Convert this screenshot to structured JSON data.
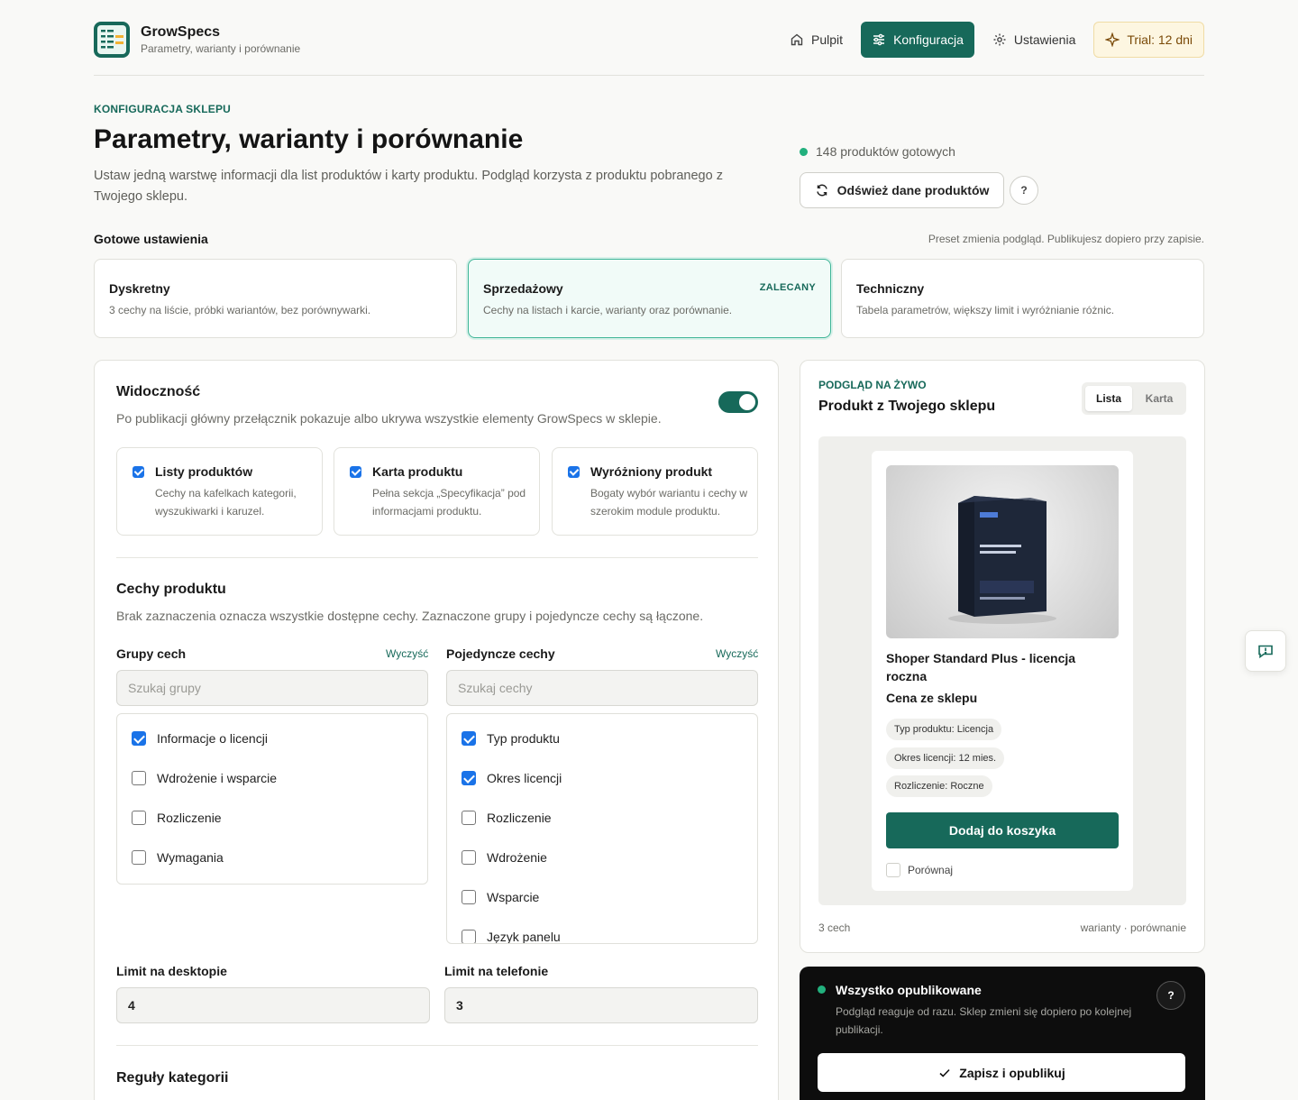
{
  "app": {
    "name": "GrowSpecs",
    "subtitle": "Parametry, warianty i porównanie"
  },
  "nav": {
    "items": [
      {
        "label": "Pulpit",
        "icon": "home-icon",
        "active": false
      },
      {
        "label": "Konfiguracja",
        "icon": "sliders-icon",
        "active": true
      },
      {
        "label": "Ustawienia",
        "icon": "gear-icon",
        "active": false
      }
    ],
    "trial": "Trial: 12 dni"
  },
  "intro": {
    "eyebrow": "KONFIGURACJA SKLEPU",
    "title": "Parametry, warianty i porównanie",
    "lead": "Ustaw jedną warstwę informacji dla list produktów i karty produktu. Podgląd korzysta z produktu pobranego z Twojego sklepu.",
    "ready_status": "148 produktów gotowych",
    "refresh_button": "Odśwież dane produktów",
    "help": "?"
  },
  "presets": {
    "label": "Gotowe ustawienia",
    "note": "Preset zmienia podgląd. Publikujesz dopiero przy zapisie.",
    "items": [
      {
        "title": "Dyskretny",
        "desc": "3 cechy na liście, próbki wariantów, bez porównywarki.",
        "badge": "",
        "selected": false
      },
      {
        "title": "Sprzedażowy",
        "desc": "Cechy na listach i karcie, warianty oraz porównanie.",
        "badge": "ZALECANY",
        "selected": true
      },
      {
        "title": "Techniczny",
        "desc": "Tabela parametrów, większy limit i wyróżnianie różnic.",
        "badge": "",
        "selected": false
      }
    ]
  },
  "visibility": {
    "title": "Widoczność",
    "desc": "Po publikacji główny przełącznik pokazuje albo ukrywa wszystkie elementy GrowSpecs w sklepie.",
    "enabled": true,
    "options": [
      {
        "title": "Listy produktów",
        "desc": "Cechy na kafelkach kategorii, wyszukiwarki i karuzel.",
        "checked": true
      },
      {
        "title": "Karta produktu",
        "desc": "Pełna sekcja „Specyfikacja” pod informacjami produktu.",
        "checked": true
      },
      {
        "title": "Wyróżniony produkt",
        "desc": "Bogaty wybór wariantu i cechy w szerokim module produktu.",
        "checked": true
      }
    ]
  },
  "features": {
    "title": "Cechy produktu",
    "desc": "Brak zaznaczenia oznacza wszystkie dostępne cechy. Zaznaczone grupy i pojedyncze cechy są łączone.",
    "groups": {
      "label": "Grupy cech",
      "clear": "Wyczyść",
      "placeholder": "Szukaj grupy",
      "items": [
        {
          "label": "Informacje o licencji",
          "checked": true
        },
        {
          "label": "Wdrożenie i wsparcie",
          "checked": false
        },
        {
          "label": "Rozliczenie",
          "checked": false
        },
        {
          "label": "Wymagania",
          "checked": false
        }
      ]
    },
    "single": {
      "label": "Pojedyncze cechy",
      "clear": "Wyczyść",
      "placeholder": "Szukaj cechy",
      "items": [
        {
          "label": "Typ produktu",
          "checked": true
        },
        {
          "label": "Okres licencji",
          "checked": true
        },
        {
          "label": "Rozliczenie",
          "checked": false
        },
        {
          "label": "Wdrożenie",
          "checked": false
        },
        {
          "label": "Wsparcie",
          "checked": false
        },
        {
          "label": "Język panelu",
          "checked": false
        }
      ]
    },
    "limit_desktop": {
      "label": "Limit na desktopie",
      "value": "4"
    },
    "limit_mobile": {
      "label": "Limit na telefonie",
      "value": "3"
    }
  },
  "category_rules": {
    "title": "Reguły kategorii"
  },
  "preview": {
    "eyebrow": "PODGLĄD NA ŻYWO",
    "title": "Produkt z Twojego sklepu",
    "tabs": [
      "Lista",
      "Karta"
    ],
    "active_tab": "Lista",
    "product": {
      "name": "Shoper Standard Plus - licencja roczna",
      "price": "Cena ze sklepu",
      "chips": [
        "Typ produktu: Licencja",
        "Okres licencji: 12 mies.",
        "Rozliczenie: Roczne"
      ],
      "add_to_cart": "Dodaj do koszyka",
      "compare": "Porównaj"
    },
    "footer_left": "3 cech",
    "footer_right": "warianty · porównanie"
  },
  "publish": {
    "title": "Wszystko opublikowane",
    "desc": "Podgląd reaguje od razu. Sklep zmieni się dopiero po kolejnej publikacji.",
    "button": "Zapisz i opublikuj",
    "help": "?"
  },
  "colors": {
    "accent": "#17695a",
    "success": "#22b07d",
    "trial_bg": "#fdf6e1"
  }
}
